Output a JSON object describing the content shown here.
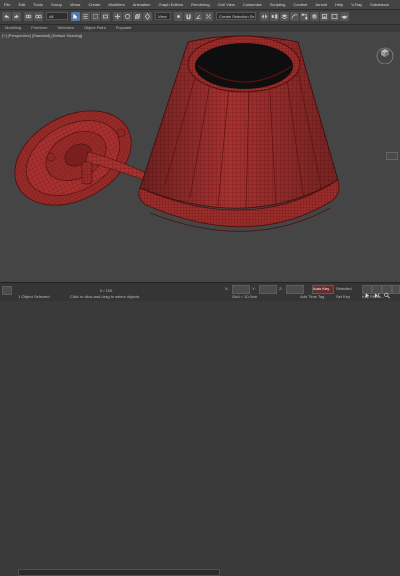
{
  "menu": {
    "items": [
      "File",
      "Edit",
      "Tools",
      "Group",
      "Views",
      "Create",
      "Modifiers",
      "Animation",
      "Graph Editors",
      "Rendering",
      "Civil View",
      "Customize",
      "Scripting",
      "Content",
      "Arnold",
      "Help",
      "V-Ray",
      "Substance"
    ]
  },
  "toolbar": {
    "selection_filter": "All",
    "view_mode": "View",
    "named_selection": "Create Selection Se"
  },
  "ribbon": {
    "tabs": [
      "Modeling",
      "Freeform",
      "Selection",
      "Object Paint",
      "Populate"
    ]
  },
  "viewport": {
    "label": "[+] [Perspective] [Standard] [Default Shading]",
    "model_color": "#a8312f",
    "wire_color": "#5a1210",
    "background": "#454545"
  },
  "status": {
    "selection_info": "1 Object Selected",
    "hint": "Click or click-and-drag to select objects",
    "frame": "0 / 100",
    "coords": {
      "x": "X:",
      "y": "Y:",
      "z": "Z:"
    },
    "grid": "Grid = 10.0cm",
    "add_time_tag": "Add Time Tag",
    "key_mode": "Auto Key",
    "selected": "Selected",
    "set_key": "Set Key",
    "key_filters": "Key Filters..."
  }
}
